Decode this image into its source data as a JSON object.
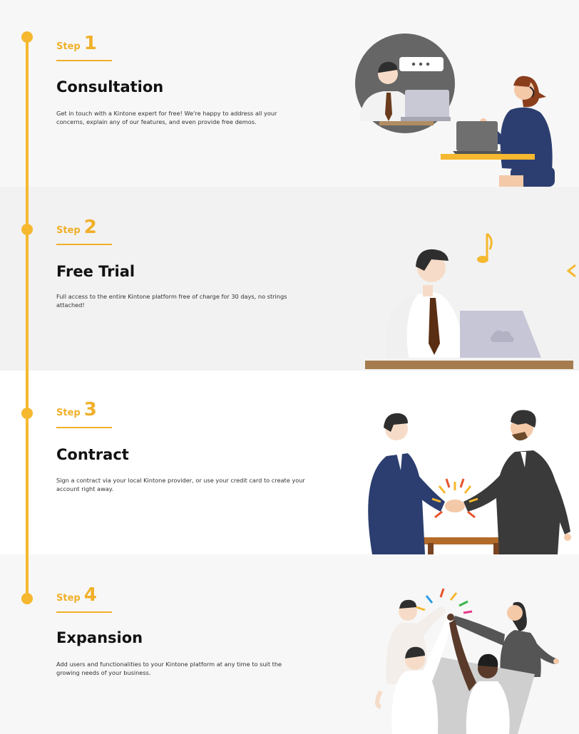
{
  "steps": [
    {
      "step_word": "Step",
      "number": "1",
      "title": "Consultation",
      "description": "Get in touch with a Kintone expert for free! We're happy to address all your concerns, explain any of our features, and even provide free demos.",
      "illustration": "consultation-illustration"
    },
    {
      "step_word": "Step",
      "number": "2",
      "title": "Free Trial",
      "description": "Full access to the entire Kintone platform free of charge for 30 days, no strings attached!",
      "illustration": "free-trial-illustration"
    },
    {
      "step_word": "Step",
      "number": "3",
      "title": "Contract",
      "description": "Sign a contract via your local Kintone provider, or use your credit card to create your account right away.",
      "illustration": "contract-illustration"
    },
    {
      "step_word": "Step",
      "number": "4",
      "title": "Expansion",
      "description": "Add users and functionalities to your Kintone platform at any time to suit the growing needs of your business.",
      "illustration": "expansion-illustration"
    }
  ],
  "colors": {
    "accent": "#f5b82e",
    "title": "#111111",
    "text": "#333333"
  }
}
